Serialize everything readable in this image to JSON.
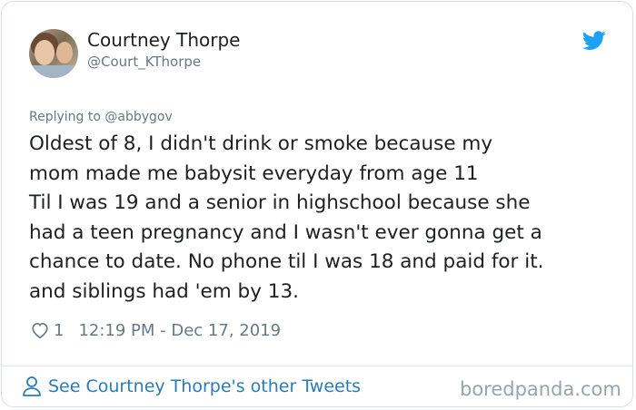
{
  "tweet": {
    "author_name": "Courtney Thorpe",
    "author_handle": "@Court_KThorpe",
    "replying_to": "Replying to @abbygov",
    "text_lines": [
      "Oldest of 8, I didn't drink or smoke because my",
      "mom made me babysit everyday from age 11",
      "Til I was 19 and a senior in highschool because she",
      "had a teen pregnancy and I wasn't ever gonna get a",
      "chance to date. No phone til I was 18 and paid for it.",
      "and siblings had 'em by 13."
    ],
    "like_count": "1",
    "timestamp": "12:19 PM - Dec 17, 2019"
  },
  "footer": {
    "other_tweets_link": "See Courtney Thorpe's other Tweets",
    "brand": "boredpanda.com"
  },
  "icons": {
    "bird": "twitter-bird-icon",
    "heart": "heart-icon",
    "person": "person-icon"
  },
  "colors": {
    "twitter_blue": "#1da1f2",
    "link_blue": "#2b7bb9",
    "muted_gray": "#697882",
    "text": "#1c2022"
  }
}
